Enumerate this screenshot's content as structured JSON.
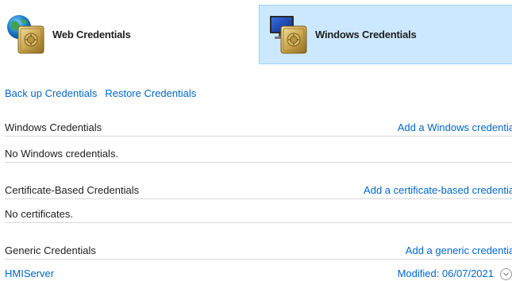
{
  "credential_types": {
    "web_label": "Web Credentials",
    "windows_label": "Windows Credentials"
  },
  "links": {
    "backup": "Back up Credentials",
    "restore": "Restore Credentials"
  },
  "sections": {
    "windows": {
      "title": "Windows Credentials",
      "add_label": "Add a Windows credential",
      "empty_text": "No Windows credentials."
    },
    "certificate": {
      "title": "Certificate-Based Credentials",
      "add_label": "Add a certificate-based credential",
      "empty_text": "No certificates."
    },
    "generic": {
      "title": "Generic Credentials",
      "add_label": "Add a generic credential",
      "items": [
        {
          "name": "HMIServer",
          "modified": "Modified:  06/07/2021"
        }
      ]
    }
  },
  "colors": {
    "link": "#0066cc",
    "selected_bg": "#cce8ff",
    "selected_border": "#99d1ff",
    "divider": "#d8d8d8"
  },
  "icons": {
    "web": "globe-vault-icon",
    "windows": "monitor-vault-icon",
    "expand": "chevron-down-icon"
  }
}
